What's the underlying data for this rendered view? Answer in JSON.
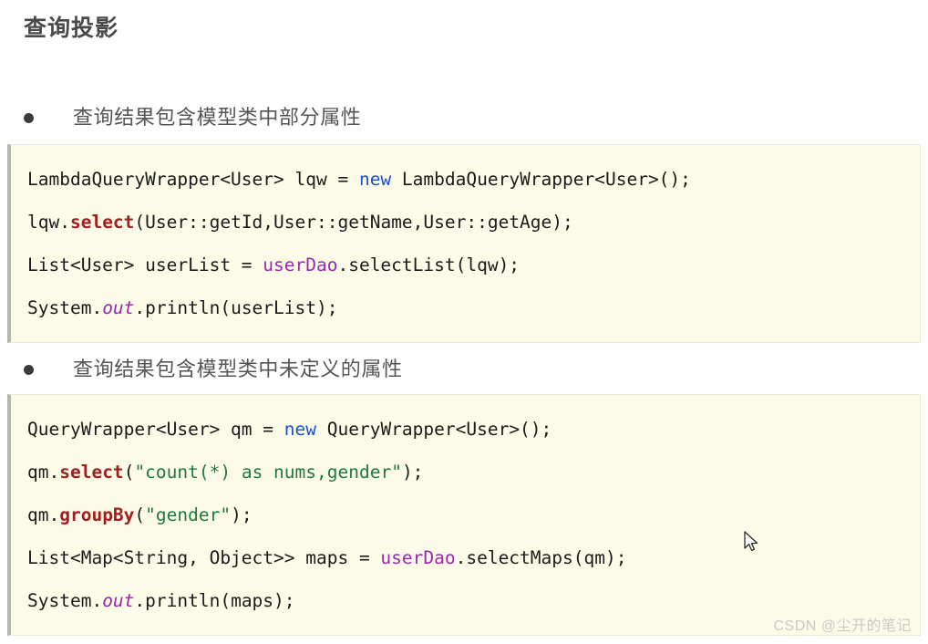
{
  "document": {
    "title": "查询投影",
    "watermark": "CSDN @尘开的笔记"
  },
  "sections": [
    {
      "bullet": "查询结果包含模型类中部分属性",
      "code_lines": [
        "LambdaQueryWrapper<User> lqw = new LambdaQueryWrapper<User>();",
        "lqw.select(User::getId,User::getName,User::getAge);",
        "List<User> userList = userDao.selectList(lqw);",
        "System.out.println(userList);"
      ]
    },
    {
      "bullet": "查询结果包含模型类中未定义的属性",
      "code_lines": [
        "QueryWrapper<User> qm = new QueryWrapper<User>();",
        "qm.select(\"count(*) as nums,gender\");",
        "qm.groupBy(\"gender\");",
        "List<Map<String, Object>> maps = userDao.selectMaps(qm);",
        "System.out.println(maps);"
      ]
    }
  ],
  "code1": {
    "l1_a": "LambdaQueryWrapper<User> lqw = ",
    "l1_kw": "new",
    "l1_b": " LambdaQueryWrapper<User>();",
    "l2_a": "lqw.",
    "l2_m": "select",
    "l2_b": "(User::getId,User::getName,User::getAge);",
    "l3_a": "List<User> userList = ",
    "l3_id": "userDao",
    "l3_b": ".selectList(lqw);",
    "l4_a": "System.",
    "l4_f": "out",
    "l4_b": ".println(userList);"
  },
  "code2": {
    "l1_a": "QueryWrapper<User> qm = ",
    "l1_kw": "new",
    "l1_b": " QueryWrapper<User>();",
    "l2_a": "qm.",
    "l2_m": "select",
    "l2_b": "(",
    "l2_s": "\"count(*) as nums,gender\"",
    "l2_c": ");",
    "l3_a": "qm.",
    "l3_m": "groupBy",
    "l3_b": "(",
    "l3_s": "\"gender\"",
    "l3_c": ");",
    "l4_a": "List<Map<String, Object>> maps = ",
    "l4_id": "userDao",
    "l4_b": ".selectMaps(qm);",
    "l5_a": "System.",
    "l5_f": "out",
    "l5_b": ".println(maps);"
  },
  "colors": {
    "code_background": "#fbfbe7",
    "code_border": "#b7b7b0",
    "keyword": "#1c4fd8",
    "method": "#a02020",
    "identifier": "#9c27b0",
    "string": "#1f7a3d",
    "title": "#4a4a4a",
    "bullet_text": "#555555",
    "watermark": "#c9c9c9"
  }
}
